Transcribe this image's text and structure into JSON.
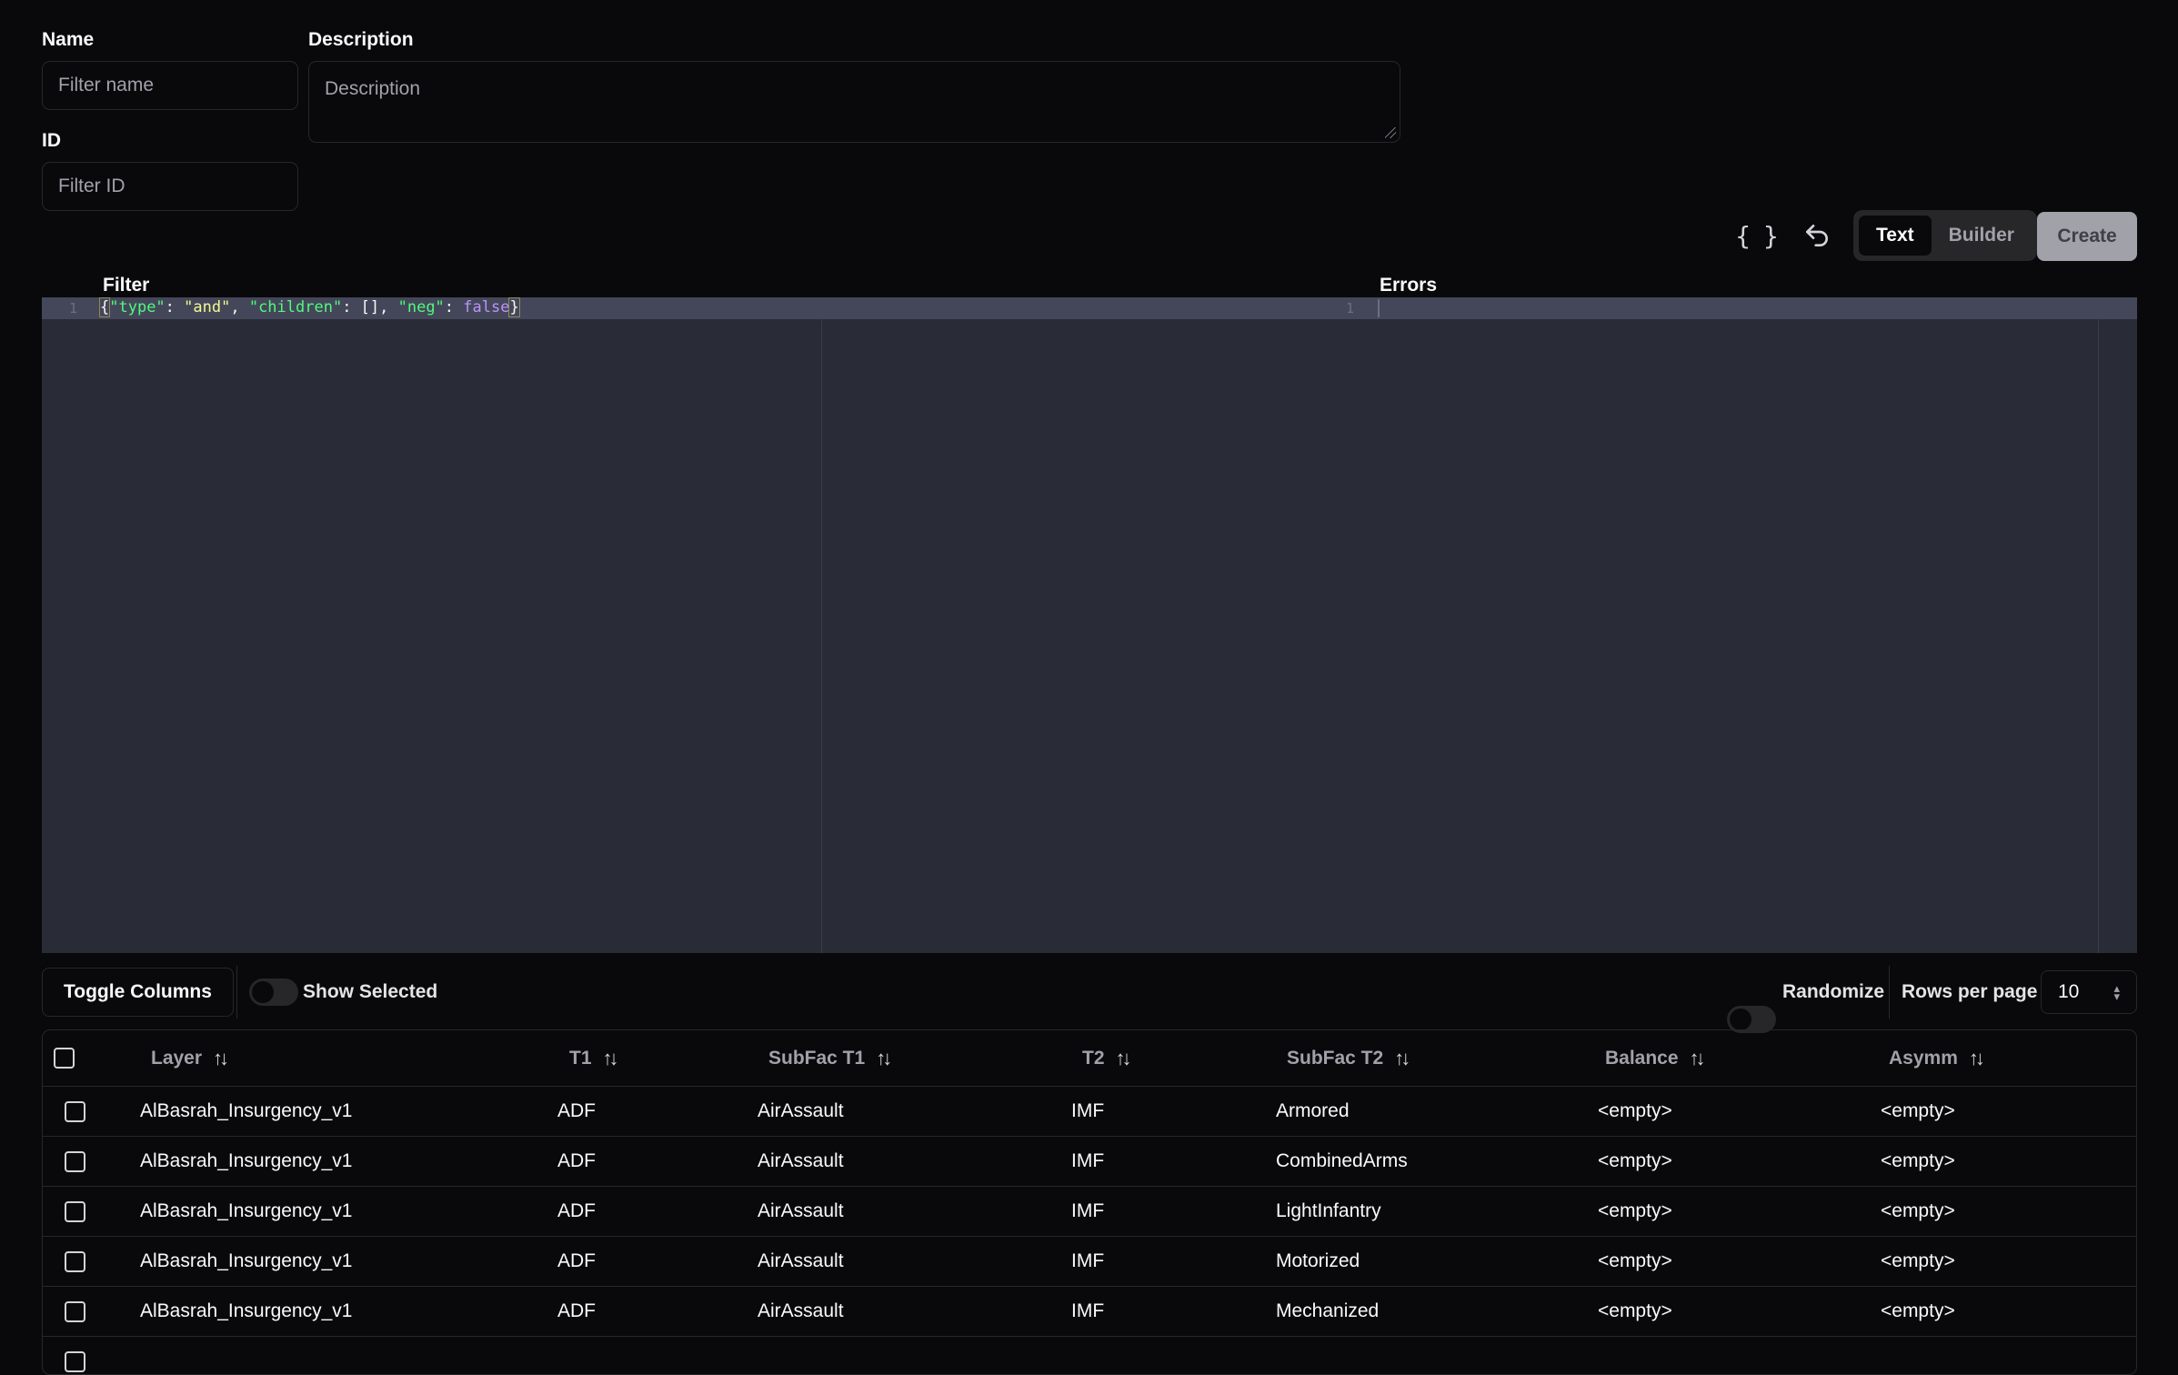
{
  "form": {
    "name_label": "Name",
    "name_placeholder": "Filter name",
    "id_label": "ID",
    "id_placeholder": "Filter ID",
    "description_label": "Description",
    "description_placeholder": "Description"
  },
  "toolbar": {
    "format_icon": "{ }",
    "undo_icon": "undo-icon",
    "mode_text": "Text",
    "mode_builder": "Builder",
    "active_mode": "Text",
    "create_label": "Create"
  },
  "editor": {
    "filter_label": "Filter",
    "errors_label": "Errors",
    "line_number": "1",
    "errors_line_number": "1",
    "code_tokens": {
      "open": "{",
      "k1": "\"type\"",
      "c1": ": ",
      "v1": "\"and\"",
      "s1": ", ",
      "k2": "\"children\"",
      "c2": ": [], ",
      "k3": "\"neg\"",
      "c3": ": ",
      "v3": "false",
      "close": "}"
    }
  },
  "table_controls": {
    "toggle_columns": "Toggle Columns",
    "show_selected": "Show Selected",
    "show_selected_on": false,
    "randomize": "Randomize",
    "randomize_on": false,
    "rows_per_page_label": "Rows per page",
    "rows_per_page_value": "10"
  },
  "table": {
    "columns": [
      "Layer",
      "T1",
      "SubFac T1",
      "T2",
      "SubFac T2",
      "Balance",
      "Asymm"
    ],
    "rows": [
      [
        "AlBasrah_Insurgency_v1",
        "ADF",
        "AirAssault",
        "IMF",
        "Armored",
        "<empty>",
        "<empty>"
      ],
      [
        "AlBasrah_Insurgency_v1",
        "ADF",
        "AirAssault",
        "IMF",
        "CombinedArms",
        "<empty>",
        "<empty>"
      ],
      [
        "AlBasrah_Insurgency_v1",
        "ADF",
        "AirAssault",
        "IMF",
        "LightInfantry",
        "<empty>",
        "<empty>"
      ],
      [
        "AlBasrah_Insurgency_v1",
        "ADF",
        "AirAssault",
        "IMF",
        "Motorized",
        "<empty>",
        "<empty>"
      ],
      [
        "AlBasrah_Insurgency_v1",
        "ADF",
        "AirAssault",
        "IMF",
        "Mechanized",
        "<empty>",
        "<empty>"
      ]
    ]
  },
  "colors": {
    "background": "#09090b",
    "editor_background": "#292b36",
    "border": "#27272a"
  }
}
